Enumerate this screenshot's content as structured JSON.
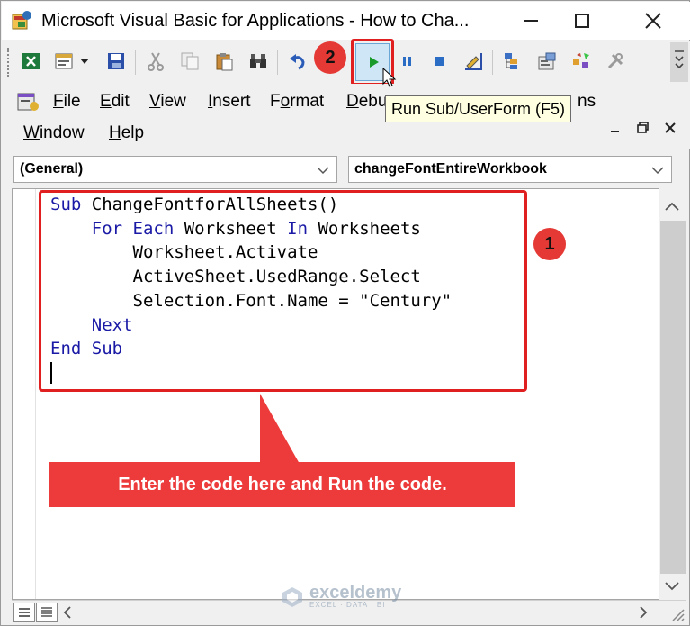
{
  "window": {
    "title": "Microsoft Visual Basic for Applications - How to Cha...",
    "controls": [
      "minimize-icon",
      "maximize-icon",
      "close-icon"
    ]
  },
  "toolbar": {
    "buttons": [
      "excel-view-icon",
      "insert-module-icon",
      "save-icon",
      "cut-icon",
      "copy-icon",
      "paste-icon",
      "find-icon",
      "undo-icon",
      "run-icon",
      "break-icon",
      "reset-icon",
      "design-mode-icon",
      "project-explorer-icon",
      "properties-icon",
      "object-browser-icon",
      "toolbox-icon"
    ],
    "run_tooltip": "Run Sub/UserForm (F5)"
  },
  "menubar": {
    "row1": [
      {
        "pre": "",
        "u": "F",
        "post": "ile"
      },
      {
        "pre": "",
        "u": "E",
        "post": "dit"
      },
      {
        "pre": "",
        "u": "V",
        "post": "iew"
      },
      {
        "pre": "",
        "u": "I",
        "post": "nsert"
      },
      {
        "pre": "F",
        "u": "o",
        "post": "rmat"
      },
      {
        "pre": "",
        "u": "D",
        "post": "ebu"
      },
      {
        "pre": "",
        "u": "",
        "post": "ns"
      }
    ],
    "row2": [
      {
        "pre": "",
        "u": "W",
        "post": "indow"
      },
      {
        "pre": "",
        "u": "H",
        "post": "elp"
      }
    ]
  },
  "dropdowns": {
    "object": "(General)",
    "procedure": "changeFontEntireWorkbook"
  },
  "code": [
    [
      {
        "t": "Sub",
        "k": 1
      },
      {
        "t": " ChangeFontforAllSheets()",
        "k": 0
      }
    ],
    [
      {
        "t": "    ",
        "k": 0
      },
      {
        "t": "For Each",
        "k": 1
      },
      {
        "t": " Worksheet ",
        "k": 0
      },
      {
        "t": "In",
        "k": 1
      },
      {
        "t": " Worksheets",
        "k": 0
      }
    ],
    [
      {
        "t": "        Worksheet.Activate",
        "k": 0
      }
    ],
    [
      {
        "t": "        ActiveSheet.UsedRange.Select",
        "k": 0
      }
    ],
    [
      {
        "t": "        Selection.Font.Name = \"Century\"",
        "k": 0
      }
    ],
    [
      {
        "t": "    ",
        "k": 0
      },
      {
        "t": "Next",
        "k": 1
      }
    ],
    [
      {
        "t": "End Sub",
        "k": 1
      }
    ]
  ],
  "annotations": {
    "badge1": "1",
    "badge2": "2",
    "callout": "Enter the code here and Run the code."
  },
  "watermark": {
    "name": "exceldemy",
    "tagline": "EXCEL · DATA · BI"
  },
  "colors": {
    "keyword": "#1a1aa6",
    "annotation_red": "#e02020",
    "callout_bg": "#ed3a3a"
  }
}
